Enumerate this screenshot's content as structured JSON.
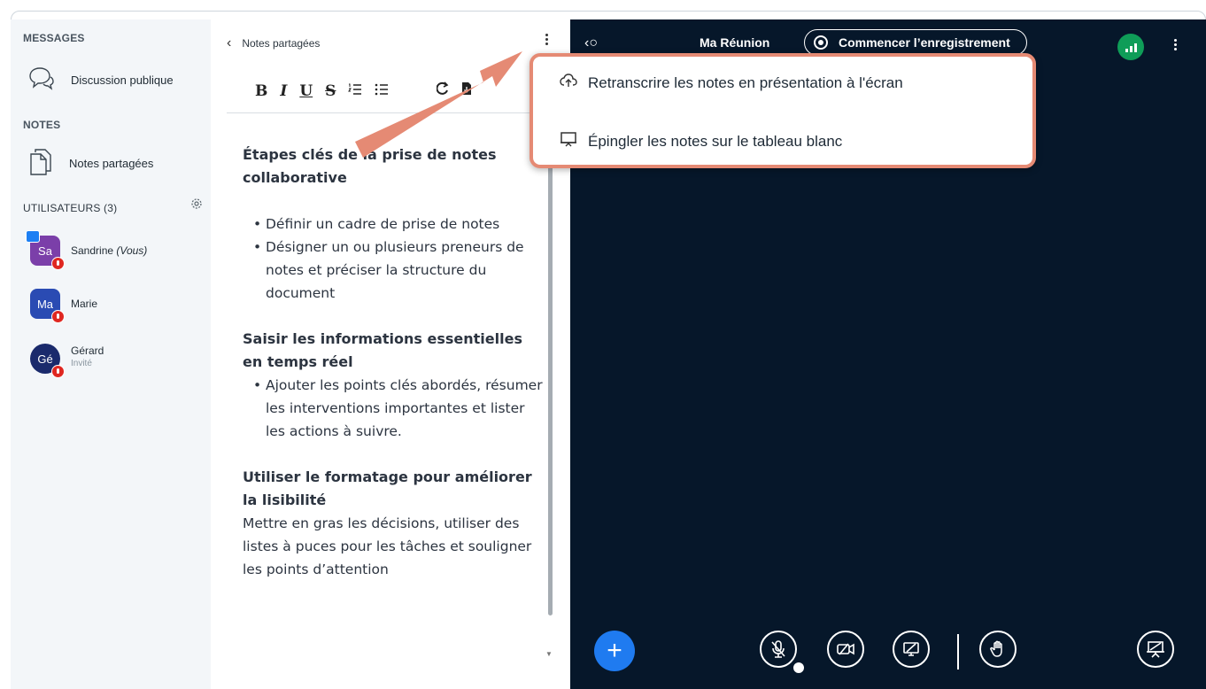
{
  "sidebar": {
    "messages_title": "MESSAGES",
    "public_chat_label": "Discussion publique",
    "notes_title": "NOTES",
    "shared_notes_label": "Notes partagées",
    "users_title": "UTILISATEURS (3)",
    "users": [
      {
        "initials": "Sa",
        "name": "Sandrine",
        "suffix": "(Vous)",
        "sub": "",
        "color": "#7b3fa9"
      },
      {
        "initials": "Ma",
        "name": "Marie",
        "suffix": "",
        "sub": "",
        "color": "#2a4bb3"
      },
      {
        "initials": "Gé",
        "name": "Gérard",
        "suffix": "",
        "sub": "Invité",
        "color": "#1a2a6c"
      }
    ]
  },
  "notes_panel": {
    "title": "Notes partagées",
    "toolbar": [
      "B",
      "I",
      "U",
      "S",
      "list-ordered",
      "list-bullet",
      "undo",
      "redo",
      "export"
    ],
    "content": {
      "h1": "Étapes clés de la prise de notes collaborative",
      "list1": [
        "Définir un cadre de prise de notes",
        "Désigner un ou plusieurs preneurs de notes et préciser la structure du document"
      ],
      "h2": "Saisir les informations essentielles en temps réel",
      "list2": [
        "Ajouter les points clés abordés, résumer les interventions importantes et lister les actions à suivre."
      ],
      "h3": "Utiliser le formatage pour améliorer la lisibilité",
      "para": "Mettre en gras les décisions, utiliser des listes à puces pour les tâches et souligner les points d’attention"
    }
  },
  "stage": {
    "meeting_title": "Ma Réunion",
    "record_label": "Commencer l’enregistrement",
    "colors": {
      "background": "#06172a",
      "accent": "#1f7bf0",
      "connection": "#0f9d58",
      "highlight": "#e58a74"
    }
  },
  "menu": {
    "item1": "Retranscrire les notes en présentation à l'écran",
    "item2": "Épingler les notes sur le tableau blanc"
  },
  "controls": [
    "plus-icon",
    "microphone-muted-icon",
    "camera-off-icon",
    "screen-share-off-icon",
    "raise-hand-icon",
    "presentation-icon"
  ]
}
